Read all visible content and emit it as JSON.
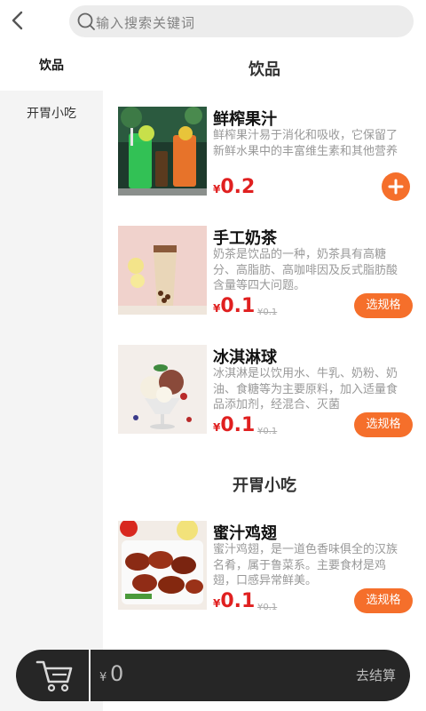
{
  "header": {
    "search_placeholder": "输入搜索关键词"
  },
  "sidebar": {
    "items": [
      {
        "label": "饮品"
      },
      {
        "label": "开胃小吃"
      }
    ]
  },
  "sections": [
    {
      "title": "饮品",
      "products": [
        {
          "name": "鲜榨果汁",
          "desc": "鲜榨果汁易于消化和吸收，它保留了新鲜水果中的丰富维生素和其他营养",
          "currency": "¥",
          "price": "0.2",
          "action": "add"
        },
        {
          "name": "手工奶茶",
          "desc": "奶茶是饮品的一种，奶茶具有高糖分、高脂肪、高咖啡因及反式脂肪酸含量等四大问题。",
          "currency": "¥",
          "price": "0.1",
          "old_price": "¥0.1",
          "action_label": "选规格"
        },
        {
          "name": "冰淇淋球",
          "desc": "冰淇淋是以饮用水、牛乳、奶粉、奶油、食糖等为主要原料，加入适量食品添加剂，经混合、灭菌",
          "currency": "¥",
          "price": "0.1",
          "old_price": "¥0.1",
          "action_label": "选规格"
        }
      ]
    },
    {
      "title": "开胃小吃",
      "products": [
        {
          "name": "蜜汁鸡翅",
          "desc": "蜜汁鸡翅，是一道色香味俱全的汉族名肴，属于鲁菜系。主要食材是鸡翅，口感异常鲜美。",
          "currency": "¥",
          "price": "0.1",
          "old_price": "¥0.1",
          "action_label": "选规格"
        }
      ]
    }
  ],
  "cart": {
    "currency": "¥",
    "total": "0",
    "checkout_label": "去结算"
  }
}
